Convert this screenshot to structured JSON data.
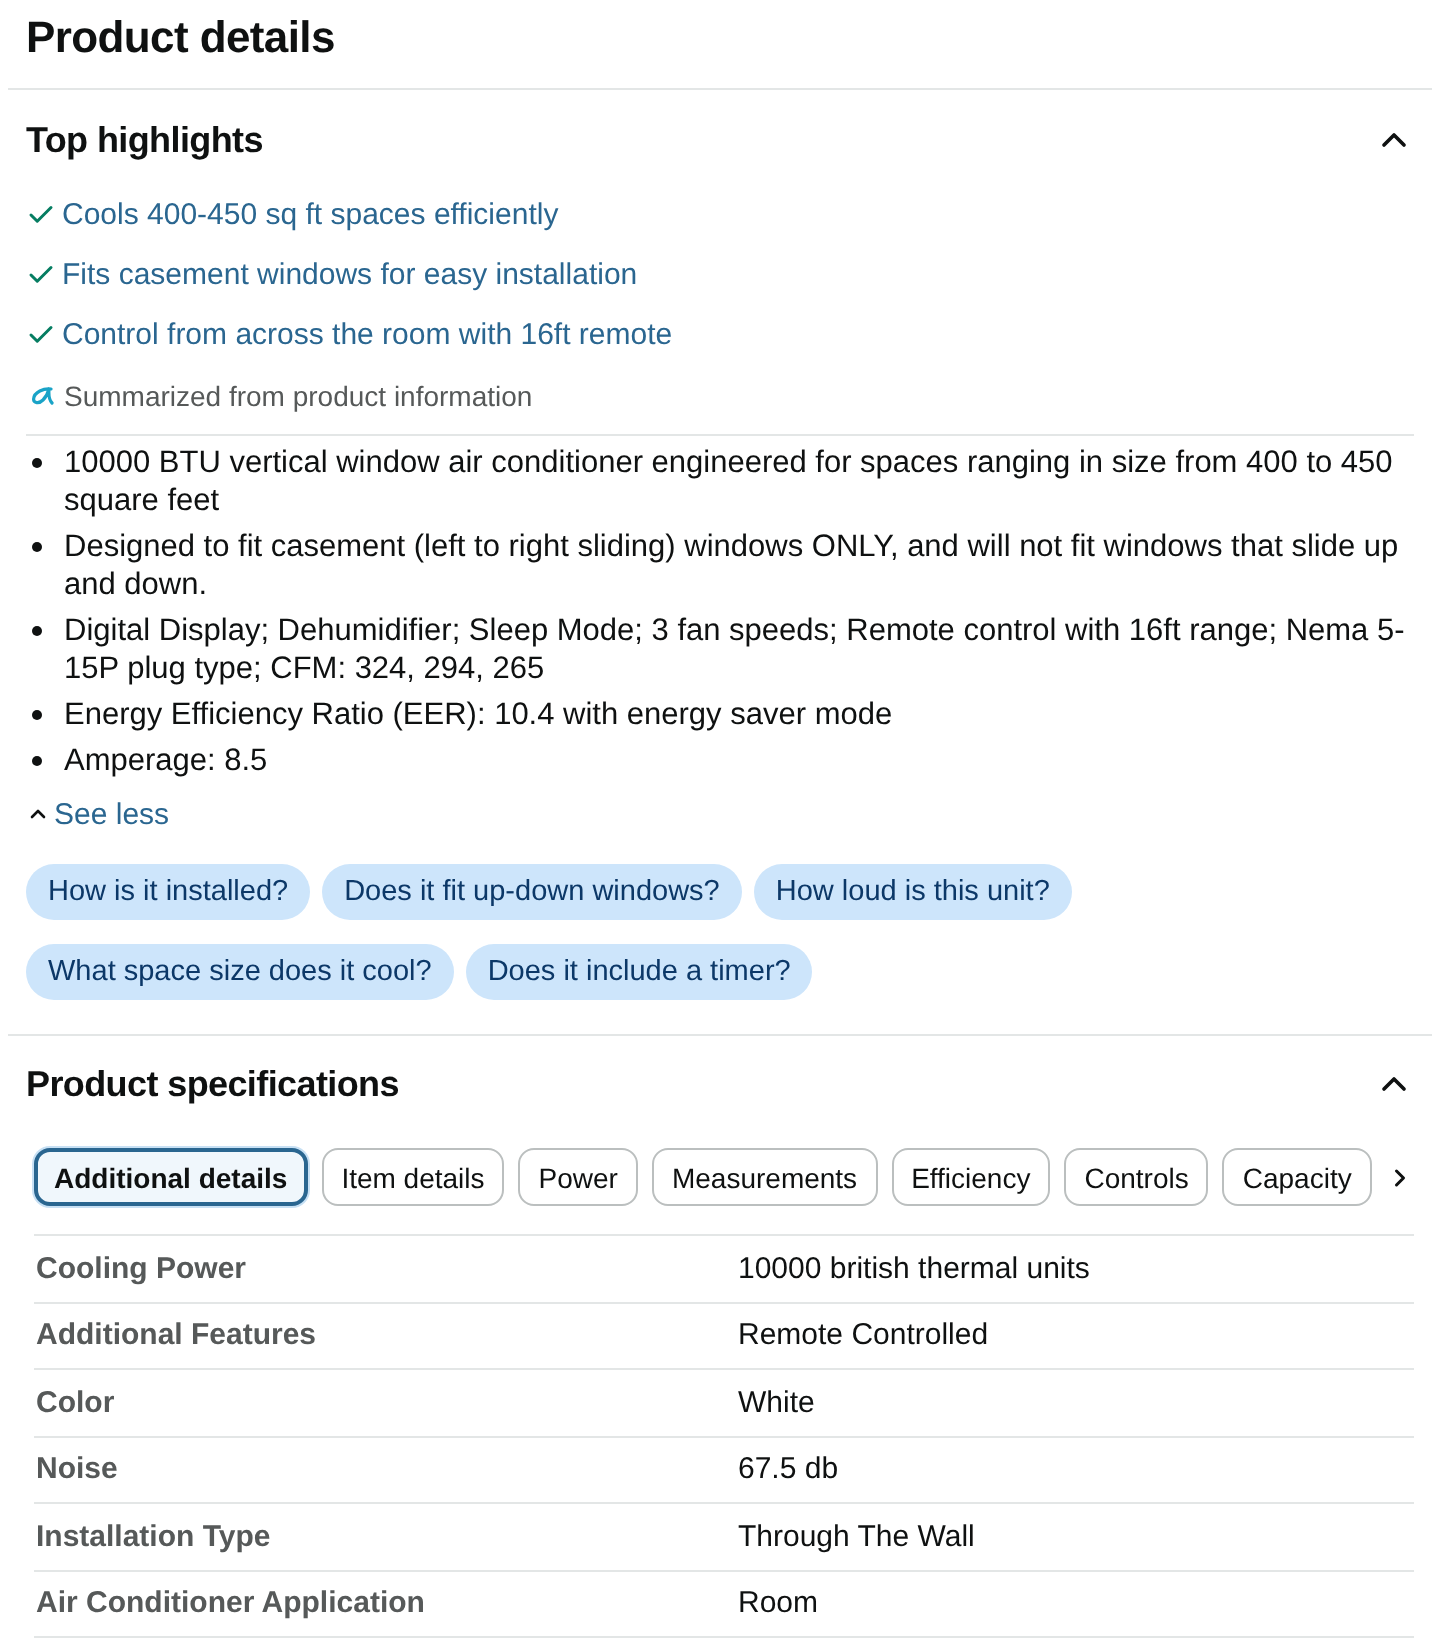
{
  "page_title": "Product details",
  "highlights_section": {
    "title": "Top highlights",
    "expanded": true,
    "highlights": [
      "Cools 400-450 sq ft spaces efficiently",
      "Fits casement windows for easy installation",
      "Control from across the room with 16ft remote"
    ],
    "summary_note": "Summarized from product information",
    "bullets": [
      "10000 BTU vertical window air conditioner engineered for spaces ranging in size from 400 to 450 square feet",
      "Designed to fit casement (left to right sliding) windows ONLY, and will not fit windows that slide up and down.",
      "Digital Display; Dehumidifier; Sleep Mode; 3 fan speeds; Remote control with 16ft range; Nema 5-15P plug type; CFM: 324, 294, 265",
      "Energy Efficiency Ratio (EER): 10.4 with energy saver mode",
      "Amperage: 8.5"
    ],
    "toggle": {
      "label": "See less",
      "expanded": true
    },
    "questions": [
      "How is it installed?",
      "Does it fit up-down windows?",
      "How loud is this unit?",
      "What space size does it cool?",
      "Does it include a timer?"
    ]
  },
  "specifications_section": {
    "title": "Product specifications",
    "expanded": true,
    "tabs": [
      {
        "label": "Additional details",
        "selected": true
      },
      {
        "label": "Item details",
        "selected": false
      },
      {
        "label": "Power",
        "selected": false
      },
      {
        "label": "Measurements",
        "selected": false
      },
      {
        "label": "Efficiency",
        "selected": false
      },
      {
        "label": "Controls",
        "selected": false
      },
      {
        "label": "Capacity",
        "selected": false
      }
    ],
    "rows": [
      {
        "label": "Cooling Power",
        "value": "10000 british thermal units"
      },
      {
        "label": "Additional Features",
        "value": "Remote Controlled"
      },
      {
        "label": "Color",
        "value": "White"
      },
      {
        "label": "Noise",
        "value": "67.5 db"
      },
      {
        "label": "Installation Type",
        "value": "Through The Wall"
      },
      {
        "label": "Air Conditioner Application",
        "value": "Room"
      }
    ]
  }
}
